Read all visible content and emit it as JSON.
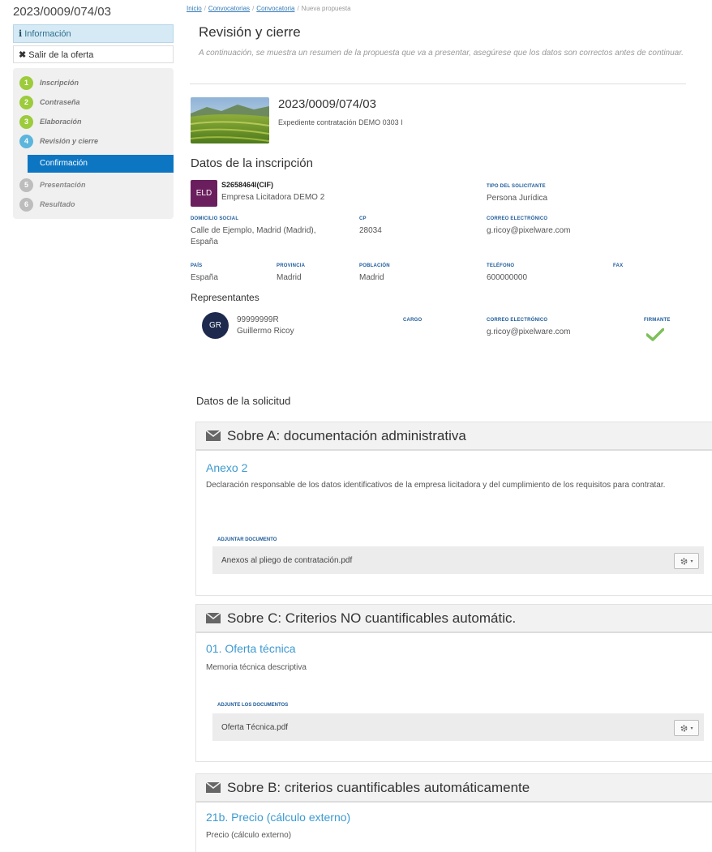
{
  "sidebar": {
    "title": "2023/0009/074/03",
    "info_label": "Información",
    "exit_label": "Salir de la oferta",
    "steps": [
      {
        "num": "1",
        "label": "Inscripción"
      },
      {
        "num": "2",
        "label": "Contraseña"
      },
      {
        "num": "3",
        "label": "Elaboración"
      },
      {
        "num": "4",
        "label": "Revisión y cierre"
      },
      {
        "num": "5",
        "label": "Presentación"
      },
      {
        "num": "6",
        "label": "Resultado"
      }
    ],
    "substep": "Confirmación"
  },
  "breadcrumb": [
    "Inicio",
    "Convocatorias",
    "Convocatoria",
    "Nueva propuesta"
  ],
  "page": {
    "title": "Revisión y cierre",
    "description": "A continuación, se muestra un resumen de la propuesta que va a presentar, asegúrese que los datos son correctos antes de continuar."
  },
  "expediente": {
    "number": "2023/0009/074/03",
    "description": "Expediente contratación DEMO 0303 I"
  },
  "inscripcion": {
    "heading": "Datos de la inscripción",
    "avatar": "ELD",
    "cif": "S2658464I(CIF)",
    "company": "Empresa Licitadora DEMO 2",
    "labels": {
      "tipo": "TIPO DEL SOLICITANTE",
      "domicilio": "DOMICILIO SOCIAL",
      "cp": "CP",
      "correo": "CORREO ELECTRÓNICO",
      "pais": "PAÍS",
      "provincia": "PROVINCIA",
      "poblacion": "POBLACIÓN",
      "telefono": "TELÉFONO",
      "fax": "FAX"
    },
    "values": {
      "tipo": "Persona Jurídica",
      "domicilio": "Calle de Ejemplo, Madrid (Madrid), España",
      "cp": "28034",
      "correo": "g.ricoy@pixelware.com",
      "pais": "España",
      "provincia": "Madrid",
      "poblacion": "Madrid",
      "telefono": "600000000"
    }
  },
  "representantes": {
    "heading": "Representantes",
    "avatar": "GR",
    "id": "99999999R",
    "name": "Guillermo Ricoy",
    "label_cargo": "CARGO",
    "label_correo": "CORREO ELECTRÓNICO",
    "correo": "g.ricoy@pixelware.com",
    "label_firmante": "FIRMANTE"
  },
  "solicitud": {
    "heading": "Datos de la solicitud",
    "sobres": [
      {
        "title": "Sobre A: documentación administrativa",
        "item_title": "Anexo 2",
        "item_desc": "Declaración responsable de los datos identificativos de la empresa licitadora y del cumplimiento de los requisitos para contratar.",
        "upload_label": "ADJUNTAR DOCUMENTO",
        "file": "Anexos al pliego de contratación.pdf"
      },
      {
        "title": "Sobre C: Criterios NO cuantificables automátic.",
        "item_title": "01. Oferta técnica",
        "item_desc": "Memoria técnica descriptiva",
        "upload_label": "ADJUNTE LOS DOCUMENTOS",
        "file": "Oferta Técnica.pdf"
      },
      {
        "title": "Sobre B: criterios cuantificables automáticamente",
        "item_title": "21b. Precio (cálculo externo)",
        "item_desc": "Precio (cálculo externo)"
      }
    ]
  },
  "colors": {
    "step_done": "#9ccb3b",
    "step_active": "#5bb5dd",
    "step_pending": "#bdbdbd",
    "substep_bg": "#0d76c3",
    "link": "#3d9ad1",
    "label": "#1c5a99",
    "check": "#7dc05a"
  }
}
